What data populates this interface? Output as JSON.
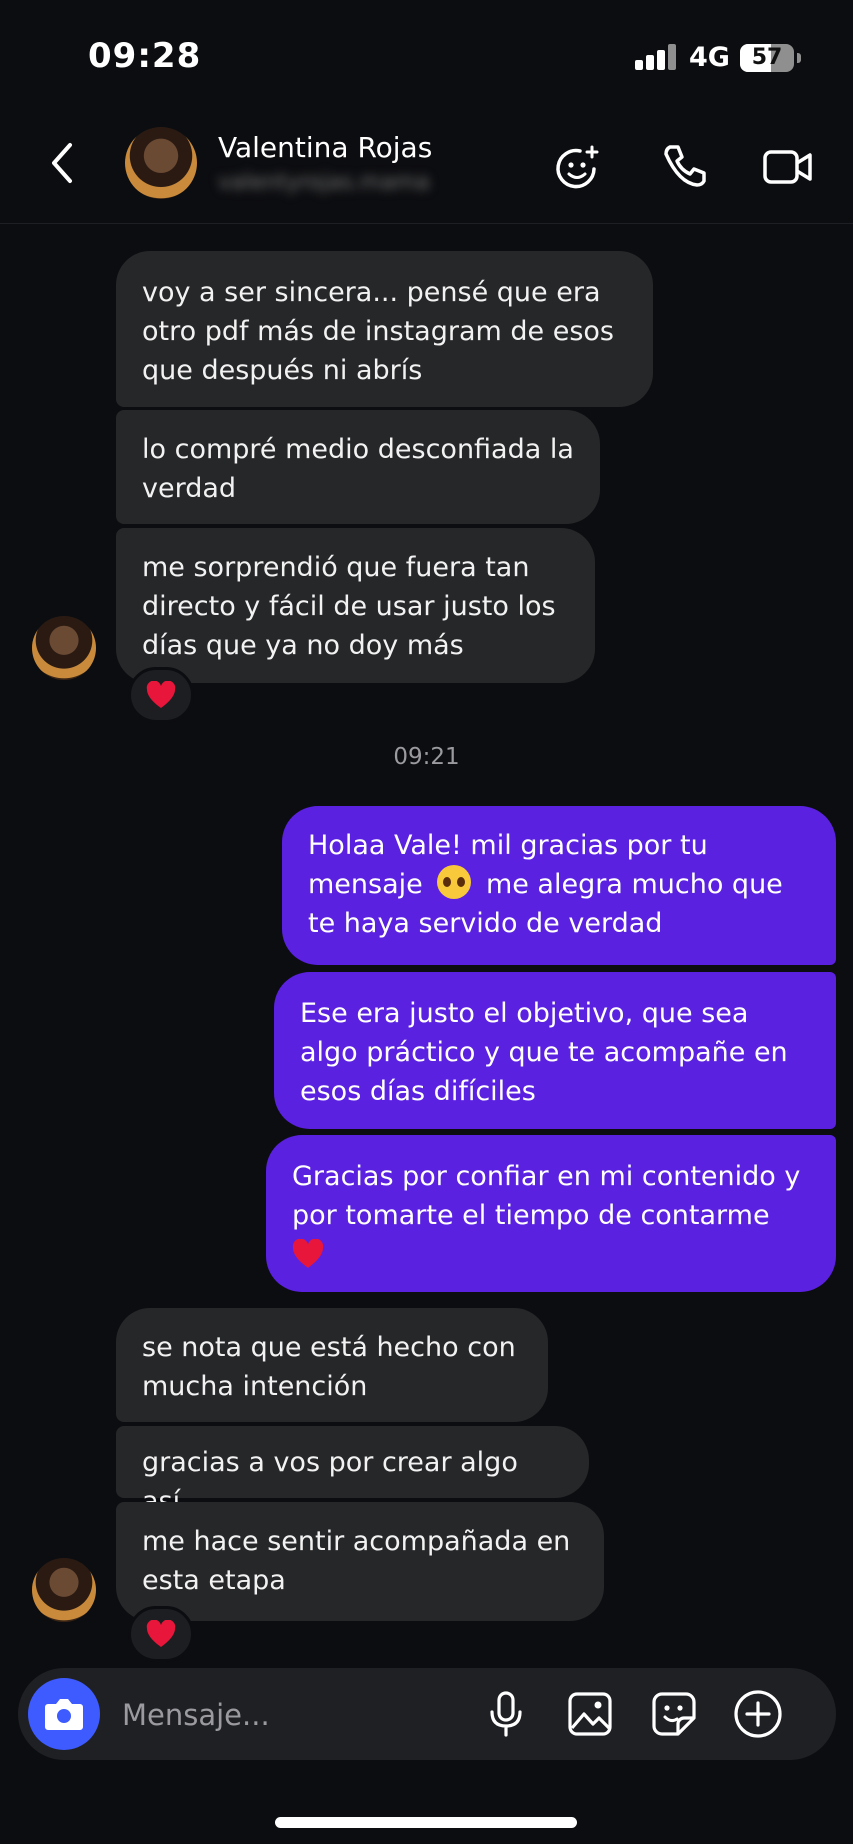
{
  "status_bar": {
    "time": "09:28",
    "network": "4G",
    "battery": "57",
    "battery_level": 0.57
  },
  "header": {
    "contact_name": "Valentina Rojas",
    "contact_username": "valentyrojas.mama",
    "icons": [
      "back-icon",
      "effects-icon",
      "phone-icon",
      "video-icon"
    ]
  },
  "messages": {
    "in1": "voy a ser sincera... pensé que era otro pdf más de instagram de esos que después ni abrís",
    "in2": "lo compré medio desconfiada la verdad",
    "in3": "me sorprendió que fuera tan directo y fácil de usar justo los días que ya no doy más",
    "timestamp": "09:21",
    "out1a": "Holaa Vale! mil gracias por tu",
    "out1b": "mensaje",
    "out1c": "me alegra mucho que",
    "out1d": "te haya servido de verdad",
    "out2": "Ese era justo el objetivo, que sea algo práctico y que te acompañe en esos días difíciles",
    "out3": "Gracias por confiar en mi contenido y por tomarte el tiempo de contarme",
    "in4": "se nota que está hecho con mucha intención",
    "in5": "gracias a vos por crear algo así",
    "in6": "me hace sentir acompañada en esta etapa"
  },
  "composer": {
    "placeholder": "Mensaje...",
    "icons": [
      "camera-icon",
      "microphone-icon",
      "gallery-icon",
      "sticker-icon",
      "plus-icon"
    ]
  },
  "colors": {
    "outgoing": "#5b21e0",
    "incoming": "#262729",
    "background": "#0c0d10",
    "camera_button": "#3d5bff"
  }
}
